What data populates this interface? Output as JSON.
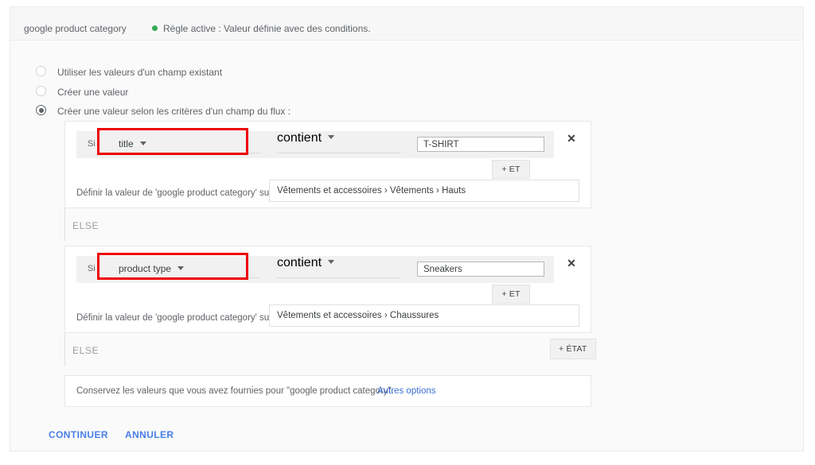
{
  "header": {
    "attribute_name": "google product category",
    "status_text": "Règle active : Valeur définie avec des conditions.",
    "status_color": "#34a853"
  },
  "options": [
    {
      "label": "Utiliser les valeurs d'un champ existant",
      "selected": false
    },
    {
      "label": "Créer une valeur",
      "selected": false
    },
    {
      "label": "Créer une valeur selon les critères d'un champ du flux :",
      "selected": true
    }
  ],
  "rules": [
    {
      "if_label": "Si",
      "field": "title",
      "operator": "contient",
      "value": "T-SHIRT",
      "and_button": "+ ET",
      "remove_icon": "✕",
      "set_label": "Définir la valeur de 'google product category' sur",
      "set_value": "Vêtements et accessoires › Vêtements › Hauts",
      "else_label": "ELSE"
    },
    {
      "if_label": "Si",
      "field": "product type",
      "operator": "contient",
      "value": "Sneakers",
      "and_button": "+ ET",
      "remove_icon": "✕",
      "set_label": "Définir la valeur de 'google product category' sur",
      "set_value": "Vêtements et accessoires › Chaussures",
      "else_label": "ELSE"
    }
  ],
  "state_button": "+ ÉTAT",
  "fallback": {
    "text": "Conservez les valeurs que vous avez fournies pour \"google product category\".",
    "link": "Autres options"
  },
  "actions": {
    "continue": "CONTINUER",
    "cancel": "ANNULER"
  },
  "annotation": {
    "color": "#ee0000"
  }
}
